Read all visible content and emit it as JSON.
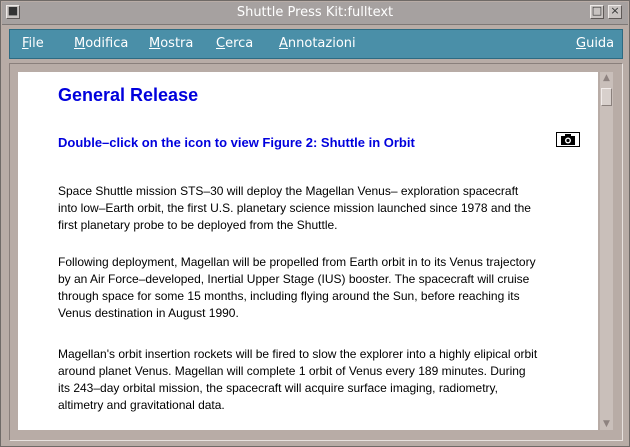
{
  "window": {
    "title": "Shuttle Press Kit:fulltext",
    "buttons": [
      "■",
      "□",
      "×"
    ]
  },
  "menu": {
    "items": [
      {
        "label": "File",
        "mnemonic": "F",
        "rest": "ile"
      },
      {
        "label": "Modifica",
        "mnemonic": "M",
        "rest": "odifica"
      },
      {
        "label": "Mostra",
        "mnemonic": "M",
        "rest": "ostra"
      },
      {
        "label": "Cerca",
        "mnemonic": "C",
        "rest": "erca"
      },
      {
        "label": "Annotazioni",
        "mnemonic": "A",
        "rest": "nnotazioni"
      }
    ],
    "help": {
      "label": "Guida",
      "mnemonic": "G",
      "rest": "uida"
    }
  },
  "document": {
    "heading": "General Release",
    "figure_link": "Double–click on the icon to view Figure 2: Shuttle in Orbit",
    "figure_icon": "camera-icon",
    "paragraphs": [
      [
        "Space Shuttle mission STS–30 will deploy the Magellan Venus– exploration spacecraft",
        "into low–Earth orbit, the first U.S. planetary science mission launched since 1978 and the",
        "first planetary probe to be deployed from the Shuttle."
      ],
      [
        "Following deployment, Magellan will be propelled from Earth orbit in to its Venus trajectory",
        "by an Air Force–developed, Inertial Upper Stage (IUS) booster.  The spacecraft will cruise",
        "through space for some 15 months, including flying around the Sun, before reaching its",
        "Venus destination in August 1990."
      ],
      [
        "Magellan's orbit insertion rockets will be fired to slow the explorer into a highly elipical orbit",
        "around planet Venus.  Magellan will complete 1 orbit of Venus every 189 minutes.  During",
        "its 243–day orbital mission, the spacecraft will acquire surface imaging, radiometry,",
        "altimetry and gravitational data."
      ]
    ]
  },
  "colors": {
    "menubar": "#4a8fa8",
    "link": "#0000dd",
    "window_frame": "#b8aca6"
  }
}
